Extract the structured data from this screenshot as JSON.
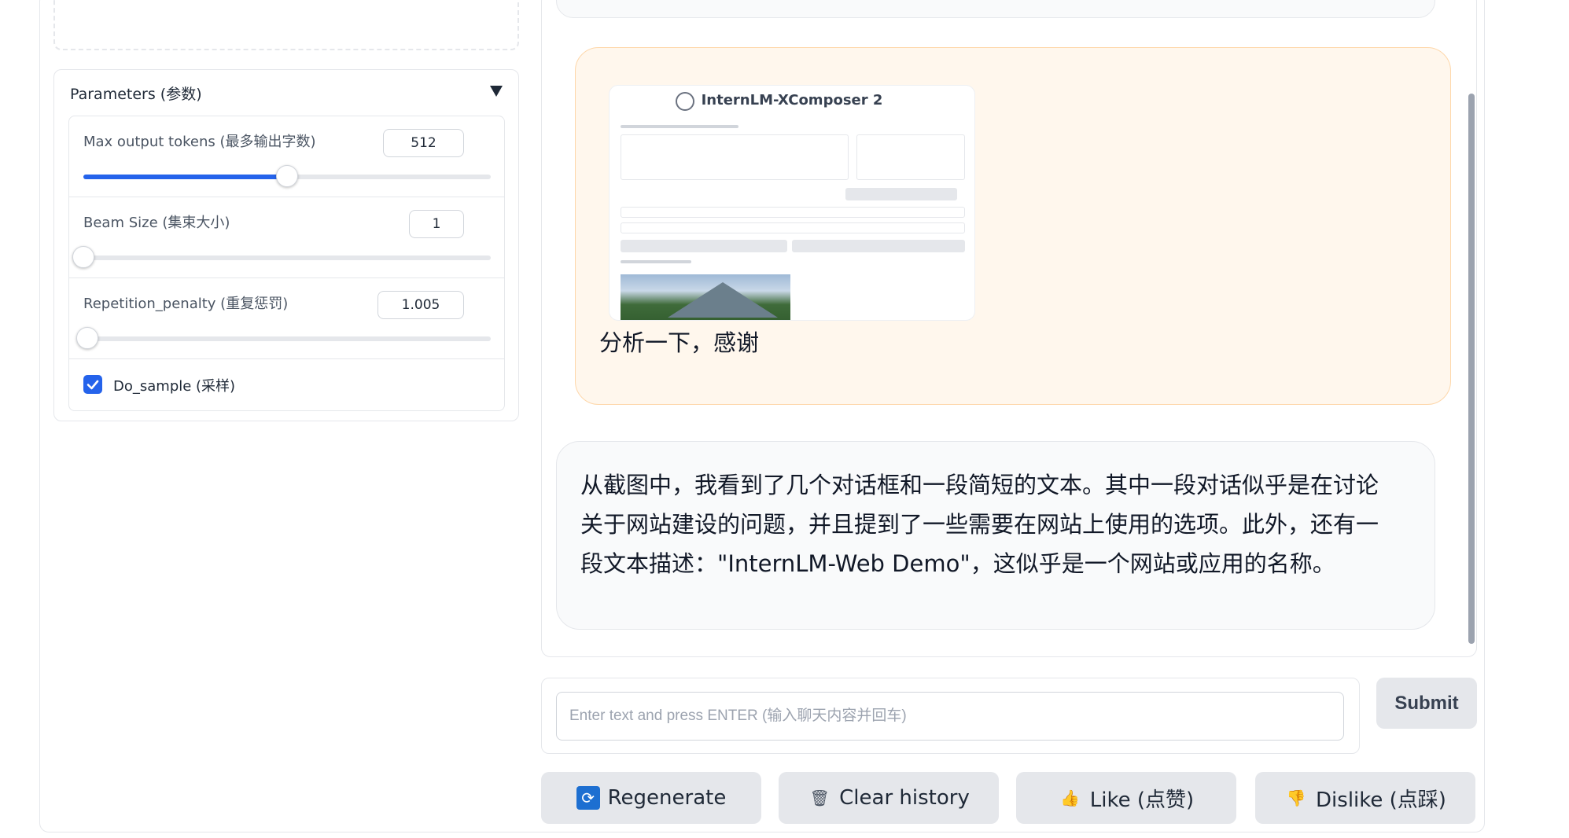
{
  "parameters": {
    "title": "Parameters (参数)",
    "max_tokens": {
      "label": "Max output tokens (最多输出字数)",
      "value": "512",
      "fraction": 0.5
    },
    "beam_size": {
      "label": "Beam Size (集束大小)",
      "value": "1",
      "fraction": 0.0
    },
    "repetition_penalty": {
      "label": "Repetition_penalty (重复惩罚)",
      "value": "1.005",
      "fraction": 0.01
    },
    "do_sample": {
      "label": "Do_sample (采样)",
      "checked": true
    }
  },
  "chat": {
    "user_text": "分析一下，感谢",
    "bot_text": "从截图中，我看到了几个对话框和一段简短的文本。其中一段对话似乎是在讨论关于网站建设的问题，并且提到了一些需要在网站上使用的选项。此外，还有一段文本描述：\"InternLM-Web Demo\"，这似乎是一个网站或应用的名称。",
    "thumbnail_title": "InternLM-XComposer 2"
  },
  "input": {
    "placeholder": "Enter text and press ENTER (输入聊天内容并回车)",
    "value": ""
  },
  "buttons": {
    "submit": "Submit",
    "regenerate": "Regenerate",
    "clear_history": "Clear history",
    "like": "Like (点赞)",
    "dislike": "Dislike (点踩)"
  },
  "icons": {
    "regenerate": "refresh-icon",
    "clear_history": "trash-icon",
    "like": "thumbs-up-icon",
    "dislike": "thumbs-down-icon",
    "collapse": "caret-down-icon"
  },
  "colors": {
    "accent": "#2563eb",
    "user_bubble": "#fff7ed",
    "bot_bubble": "#f9fafb",
    "button": "#e5e7eb"
  }
}
